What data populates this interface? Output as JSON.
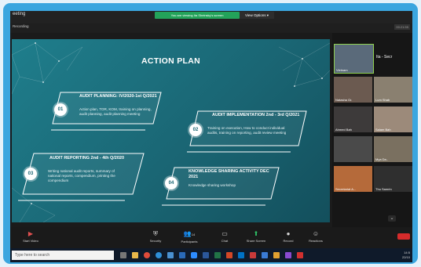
{
  "window": {
    "title": "eeting",
    "share_banner": "You are viewing Ita Sheinsky's screen",
    "view_options": "View Options",
    "top_right": "",
    "host_name": "Recording",
    "clock": "00:21:55"
  },
  "slide": {
    "title": "ACTION PLAN",
    "cards": [
      {
        "num": "01",
        "title": "AUDIT PLANNING: IV/2020-1st Q/2021",
        "text": "Action plan, TOR, KOM, training on planning, audit planning, audit planning meeting"
      },
      {
        "num": "02",
        "title": "AUDIT IMPLEMENTATION 2nd - 3rd Q/2021",
        "text": "Training on execution, How to conduct individual audits, training on reporting, audit review meeting"
      },
      {
        "num": "03",
        "title": "AUDIT REPORTING 2nd - 4th Q/2020",
        "text": "Writing national audit reports, summary of national reports, compendium, printing the compendium"
      },
      {
        "num": "04",
        "title": "KNOWLEDGE SHARING ACTIVITY DEC 2021",
        "text": "Knowledge sharing workshop"
      }
    ]
  },
  "gallery": {
    "more_label": "Ita - Secr",
    "participants": [
      {
        "name": "Vietnam",
        "color": "#5a6a7a"
      },
      {
        "name": "Natasha Gr.",
        "color": "#6b5a50"
      },
      {
        "name": "Lum Shab",
        "color": "#8a8070"
      },
      {
        "name": "Ahmed Bah",
        "color": "#3d3a3a"
      },
      {
        "name": "Salam Bah",
        "color": "#9c8a7a"
      },
      {
        "name": "",
        "color": "#4a4a4a"
      },
      {
        "name": "Mya Da..",
        "color": "#7a7060"
      },
      {
        "name": "Secretariat A...",
        "color": "#b56a3a"
      },
      {
        "name": "Thu Samrin",
        "color": "#2f2f2f"
      }
    ]
  },
  "toolbar": {
    "buttons": [
      {
        "label": "Start Video",
        "icon": "video-off-icon",
        "glyph": "▶"
      },
      {
        "label": "Security",
        "icon": "shield-icon",
        "glyph": "⛨"
      },
      {
        "label": "Participants",
        "icon": "participants-icon",
        "glyph": "👥",
        "count": "14"
      },
      {
        "label": "Chat",
        "icon": "chat-icon",
        "glyph": "▭"
      },
      {
        "label": "Share Screen",
        "icon": "share-screen-icon",
        "glyph": "⬆"
      },
      {
        "label": "Record",
        "icon": "record-icon",
        "glyph": "●"
      },
      {
        "label": "Reactions",
        "icon": "reactions-icon",
        "glyph": "☺"
      }
    ]
  },
  "taskbar": {
    "search_placeholder": "Type here to search",
    "tray_time": "14:5",
    "tray_date": "22/10"
  }
}
